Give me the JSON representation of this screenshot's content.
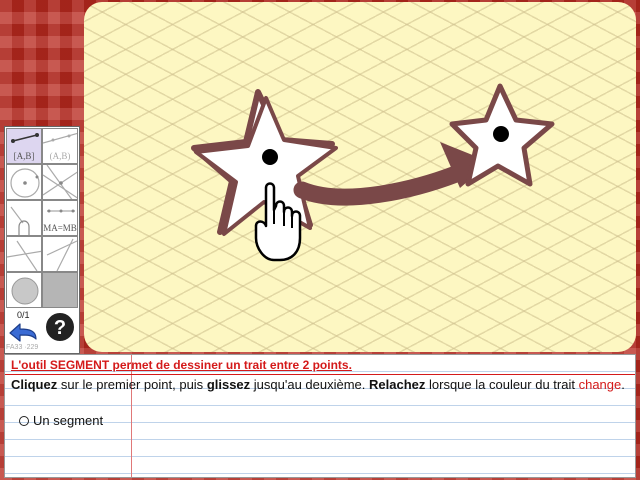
{
  "toolbar": {
    "tools": [
      {
        "name": "segment",
        "label": "[A,B]",
        "active": true
      },
      {
        "name": "line",
        "label": "(A,B)",
        "active": false
      },
      {
        "name": "circle",
        "label": "",
        "active": false
      },
      {
        "name": "lines-through-point",
        "label": "",
        "active": false
      },
      {
        "name": "arc",
        "label": "",
        "active": false
      },
      {
        "name": "midpoint",
        "label": "MA=MB",
        "active": false
      },
      {
        "name": "perpendicular",
        "label": "",
        "active": false
      },
      {
        "name": "angle",
        "label": "",
        "active": false
      },
      {
        "name": "fill-color",
        "label": "",
        "active": false
      },
      {
        "name": "gray-swatch",
        "label": "",
        "active": false
      }
    ],
    "counter": "0/1",
    "footer_id": "FA33 ·229"
  },
  "notebook": {
    "title": "L'outil SEGMENT permet de dessiner un trait entre 2 points.",
    "instr_w1": "Cliquez",
    "instr_t1": " sur le premier point, puis ",
    "instr_w2": "glissez",
    "instr_t2": " jusqu'au deuxième. ",
    "instr_w3": "Relachez",
    "instr_t3": " lorsque la couleur du trait ",
    "instr_w4": "change",
    "instr_t4": ".",
    "option_label": "Un segment"
  },
  "colors": {
    "title_red": "#d41a1a",
    "star_stroke": "#7a4848",
    "arrow": "#7a4848",
    "board_bg": "#fdf7c2"
  }
}
